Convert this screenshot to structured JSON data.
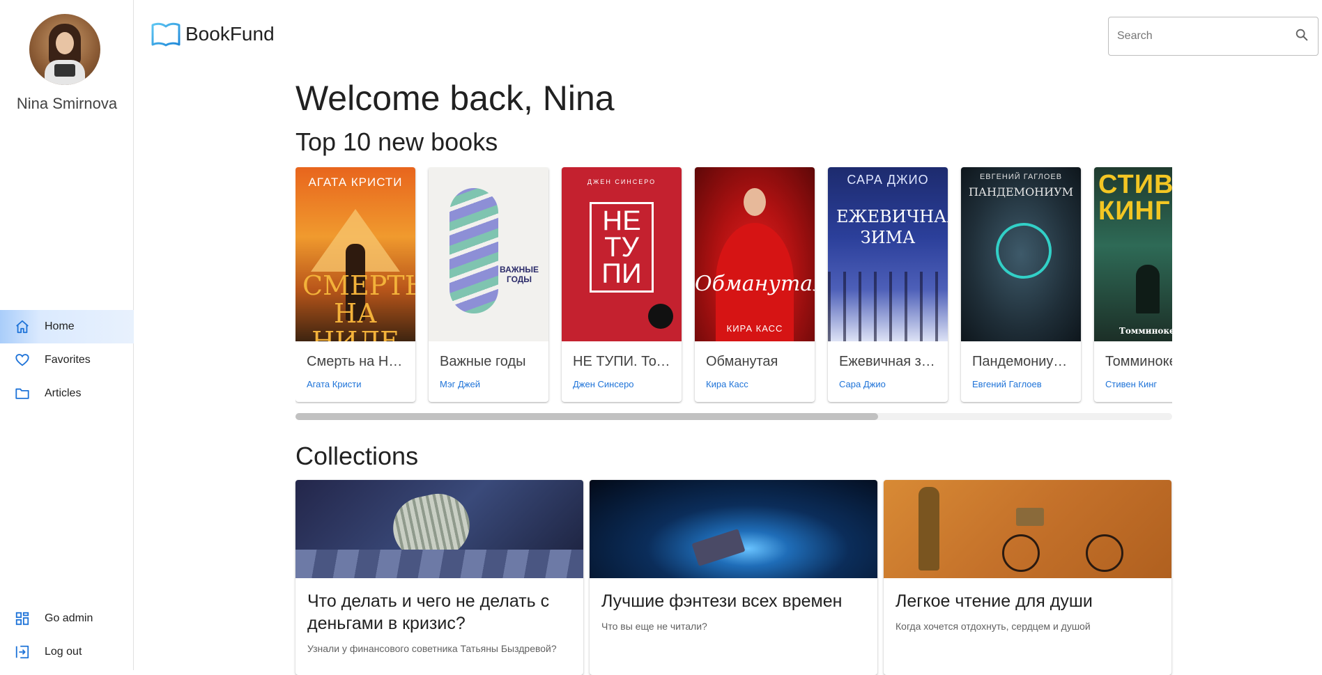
{
  "user": {
    "name": "Nina Smirnova"
  },
  "nav": {
    "items": [
      {
        "label": "Home",
        "icon": "home-icon",
        "active": true
      },
      {
        "label": "Favorites",
        "icon": "heart-icon"
      },
      {
        "label": "Articles",
        "icon": "folder-icon"
      }
    ],
    "bottom": [
      {
        "label": "Go admin",
        "icon": "dashboard-icon"
      },
      {
        "label": "Log out",
        "icon": "logout-icon"
      }
    ]
  },
  "header": {
    "brand": "BookFund",
    "search_placeholder": "Search"
  },
  "main": {
    "welcome": "Welcome back, Nina",
    "top_books_title": "Top 10 new books",
    "collections_title": "Collections"
  },
  "books": [
    {
      "title": "Смерть на Ниле",
      "author": "Агата Кристи",
      "cover_author": "АГАТА КРИСТИ",
      "cover_title": "СМЕРТЬ НА НИЛЕ"
    },
    {
      "title": "Важные годы",
      "author": "Мэг Джей",
      "cover_title": "ВАЖНЫЕ ГОДЫ"
    },
    {
      "title": "НЕ ТУПИ. Только тот, кто постоянно работает над собой, живет значимой жизнью",
      "author": "Джен Синсеро",
      "cover_author": "ДЖЕН СИНСЕРО",
      "cover_title": "НЕ ТУ ПИ"
    },
    {
      "title": "Обманутая",
      "author": "Кира Касс",
      "cover_author": "КИРА КАСС",
      "cover_title": "Обманутая"
    },
    {
      "title": "Ежевичная зима",
      "author": "Сара Джио",
      "cover_author": "САРА ДЖИО",
      "cover_title": "ЕЖЕВИЧНАЯ ЗИМА"
    },
    {
      "title": "Пандемониум. Город темных секретов",
      "author": "Евгений Гаглоев",
      "cover_author": "ЕВГЕНИЙ ГАГЛОЕВ",
      "cover_title": "ПАНДЕМОНИУМ"
    },
    {
      "title": "Томминокеры",
      "author": "Стивен Кинг",
      "cover_author": "СТИВЕН КИНГ",
      "cover_title": "Томминокеры"
    }
  ],
  "collections": [
    {
      "title": "Что делать и чего не делать с деньгами в кризис?",
      "subtitle": "Узнали у финансового советника Татьяны Быздревой?"
    },
    {
      "title": "Лучшие фэнтези всех времен",
      "subtitle": "Что вы еще не читали?"
    },
    {
      "title": "Легкое чтение для души",
      "subtitle": "Когда хочется отдохнуть, сердцем и душой"
    }
  ],
  "colors": {
    "accent": "#1e73d8",
    "active_nav": "#dbeafe"
  }
}
